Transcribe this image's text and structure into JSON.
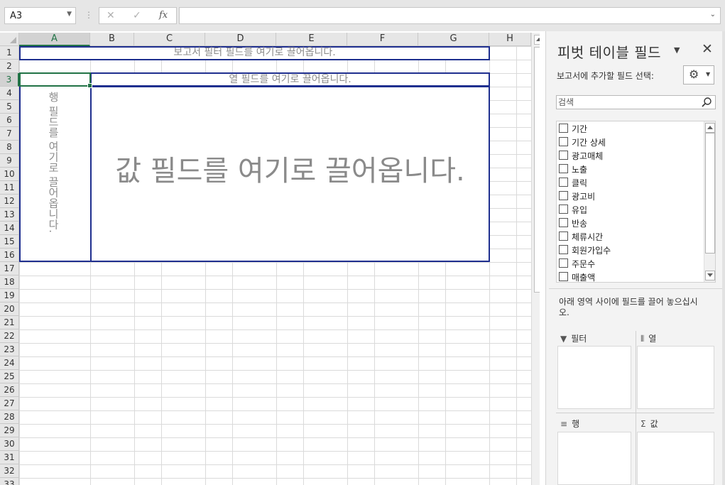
{
  "formula_bar": {
    "name_box": "A3",
    "separator": "⋮",
    "cancel_icon": "✕",
    "enter_icon": "✓",
    "fx_label": "fx",
    "formula": ""
  },
  "sheet": {
    "columns": [
      "A",
      "B",
      "C",
      "D",
      "E",
      "F",
      "G",
      "H"
    ],
    "rows": [
      "1",
      "2",
      "3",
      "4",
      "5",
      "6",
      "7",
      "8",
      "9",
      "10",
      "11",
      "12",
      "13",
      "14",
      "15",
      "16",
      "17",
      "18",
      "19",
      "20",
      "21",
      "22",
      "23",
      "24",
      "25",
      "26",
      "27",
      "28",
      "29",
      "30",
      "31",
      "32",
      "33"
    ],
    "selected_cell": "A3",
    "pivot_placeholders": {
      "filter": "보고서 필터 필드를 여기로 끌어옵니다.",
      "columns": "열 필드를 여기로 끌어옵니다.",
      "rows": "행 필드를 여기로 끌어옵니다.",
      "values": "값 필드를 여기로 끌어옵니다."
    }
  },
  "pivot_pane": {
    "title": "피벗 테이블 필드",
    "subtitle": "보고서에 추가할 필드 선택:",
    "search_placeholder": "검색",
    "fields": [
      {
        "label": "기간",
        "checked": false
      },
      {
        "label": "기간 상세",
        "checked": false
      },
      {
        "label": "광고매체",
        "checked": false
      },
      {
        "label": "노출",
        "checked": false
      },
      {
        "label": "클릭",
        "checked": false
      },
      {
        "label": "광고비",
        "checked": false
      },
      {
        "label": "유입",
        "checked": false
      },
      {
        "label": "반송",
        "checked": false
      },
      {
        "label": "체류시간",
        "checked": false
      },
      {
        "label": "회원가입수",
        "checked": false
      },
      {
        "label": "주문수",
        "checked": false
      },
      {
        "label": "매출액",
        "checked": false
      }
    ],
    "hint": "아래 영역 사이에 필드를 끌어 놓으십시오.",
    "areas": {
      "filter": "필터",
      "columns": "열",
      "rows": "행",
      "values": "값"
    }
  }
}
